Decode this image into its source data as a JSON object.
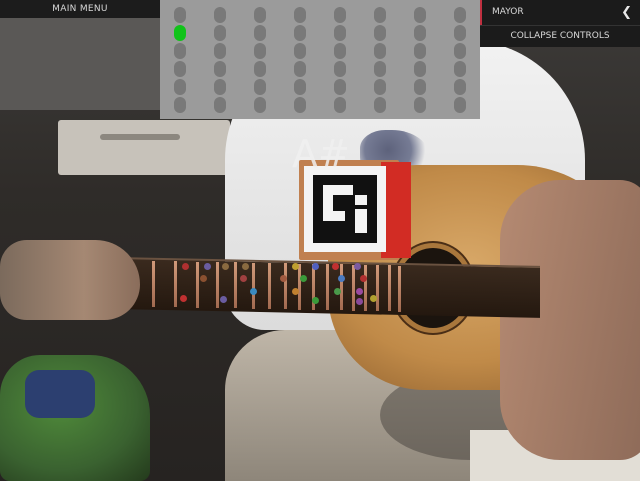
{
  "menu": {
    "main_label": "MAIN MENU"
  },
  "scale": {
    "selected": "MAYOR"
  },
  "controls": {
    "collapse_label": "COLLAPSE CONTROLS"
  },
  "overlay": {
    "chord": "A#"
  },
  "string_panel": {
    "columns": 8,
    "rows": 6,
    "active": [
      {
        "column": 1,
        "row": 2
      }
    ],
    "colors": {
      "inactive": "#797979",
      "active": "#11c31a",
      "panel": "#9b9b9b"
    }
  },
  "icons": {
    "collapse_chevron": "chevron-left-icon"
  },
  "colors": {
    "accent": "#c03040",
    "bar_bg": "#1b1b1b"
  }
}
